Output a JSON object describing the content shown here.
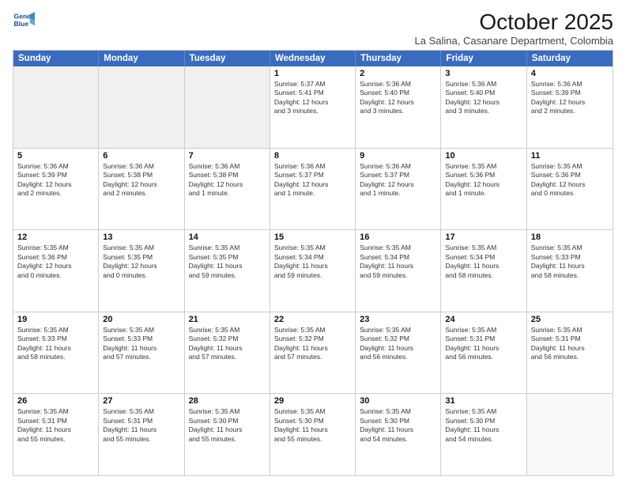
{
  "logo": {
    "line1": "General",
    "line2": "Blue"
  },
  "title": "October 2025",
  "subtitle": "La Salina, Casanare Department, Colombia",
  "header_days": [
    "Sunday",
    "Monday",
    "Tuesday",
    "Wednesday",
    "Thursday",
    "Friday",
    "Saturday"
  ],
  "rows": [
    [
      {
        "day": "",
        "info": ""
      },
      {
        "day": "",
        "info": ""
      },
      {
        "day": "",
        "info": ""
      },
      {
        "day": "1",
        "info": "Sunrise: 5:37 AM\nSunset: 5:41 PM\nDaylight: 12 hours\nand 3 minutes."
      },
      {
        "day": "2",
        "info": "Sunrise: 5:36 AM\nSunset: 5:40 PM\nDaylight: 12 hours\nand 3 minutes."
      },
      {
        "day": "3",
        "info": "Sunrise: 5:36 AM\nSunset: 5:40 PM\nDaylight: 12 hours\nand 3 minutes."
      },
      {
        "day": "4",
        "info": "Sunrise: 5:36 AM\nSunset: 5:39 PM\nDaylight: 12 hours\nand 2 minutes."
      }
    ],
    [
      {
        "day": "5",
        "info": "Sunrise: 5:36 AM\nSunset: 5:39 PM\nDaylight: 12 hours\nand 2 minutes."
      },
      {
        "day": "6",
        "info": "Sunrise: 5:36 AM\nSunset: 5:38 PM\nDaylight: 12 hours\nand 2 minutes."
      },
      {
        "day": "7",
        "info": "Sunrise: 5:36 AM\nSunset: 5:38 PM\nDaylight: 12 hours\nand 1 minute."
      },
      {
        "day": "8",
        "info": "Sunrise: 5:36 AM\nSunset: 5:37 PM\nDaylight: 12 hours\nand 1 minute."
      },
      {
        "day": "9",
        "info": "Sunrise: 5:36 AM\nSunset: 5:37 PM\nDaylight: 12 hours\nand 1 minute."
      },
      {
        "day": "10",
        "info": "Sunrise: 5:35 AM\nSunset: 5:36 PM\nDaylight: 12 hours\nand 1 minute."
      },
      {
        "day": "11",
        "info": "Sunrise: 5:35 AM\nSunset: 5:36 PM\nDaylight: 12 hours\nand 0 minutes."
      }
    ],
    [
      {
        "day": "12",
        "info": "Sunrise: 5:35 AM\nSunset: 5:36 PM\nDaylight: 12 hours\nand 0 minutes."
      },
      {
        "day": "13",
        "info": "Sunrise: 5:35 AM\nSunset: 5:35 PM\nDaylight: 12 hours\nand 0 minutes."
      },
      {
        "day": "14",
        "info": "Sunrise: 5:35 AM\nSunset: 5:35 PM\nDaylight: 11 hours\nand 59 minutes."
      },
      {
        "day": "15",
        "info": "Sunrise: 5:35 AM\nSunset: 5:34 PM\nDaylight: 11 hours\nand 59 minutes."
      },
      {
        "day": "16",
        "info": "Sunrise: 5:35 AM\nSunset: 5:34 PM\nDaylight: 11 hours\nand 59 minutes."
      },
      {
        "day": "17",
        "info": "Sunrise: 5:35 AM\nSunset: 5:34 PM\nDaylight: 11 hours\nand 58 minutes."
      },
      {
        "day": "18",
        "info": "Sunrise: 5:35 AM\nSunset: 5:33 PM\nDaylight: 11 hours\nand 58 minutes."
      }
    ],
    [
      {
        "day": "19",
        "info": "Sunrise: 5:35 AM\nSunset: 5:33 PM\nDaylight: 11 hours\nand 58 minutes."
      },
      {
        "day": "20",
        "info": "Sunrise: 5:35 AM\nSunset: 5:33 PM\nDaylight: 11 hours\nand 57 minutes."
      },
      {
        "day": "21",
        "info": "Sunrise: 5:35 AM\nSunset: 5:32 PM\nDaylight: 11 hours\nand 57 minutes."
      },
      {
        "day": "22",
        "info": "Sunrise: 5:35 AM\nSunset: 5:32 PM\nDaylight: 11 hours\nand 57 minutes."
      },
      {
        "day": "23",
        "info": "Sunrise: 5:35 AM\nSunset: 5:32 PM\nDaylight: 11 hours\nand 56 minutes."
      },
      {
        "day": "24",
        "info": "Sunrise: 5:35 AM\nSunset: 5:31 PM\nDaylight: 11 hours\nand 56 minutes."
      },
      {
        "day": "25",
        "info": "Sunrise: 5:35 AM\nSunset: 5:31 PM\nDaylight: 11 hours\nand 56 minutes."
      }
    ],
    [
      {
        "day": "26",
        "info": "Sunrise: 5:35 AM\nSunset: 5:31 PM\nDaylight: 11 hours\nand 55 minutes."
      },
      {
        "day": "27",
        "info": "Sunrise: 5:35 AM\nSunset: 5:31 PM\nDaylight: 11 hours\nand 55 minutes."
      },
      {
        "day": "28",
        "info": "Sunrise: 5:35 AM\nSunset: 5:30 PM\nDaylight: 11 hours\nand 55 minutes."
      },
      {
        "day": "29",
        "info": "Sunrise: 5:35 AM\nSunset: 5:30 PM\nDaylight: 11 hours\nand 55 minutes."
      },
      {
        "day": "30",
        "info": "Sunrise: 5:35 AM\nSunset: 5:30 PM\nDaylight: 11 hours\nand 54 minutes."
      },
      {
        "day": "31",
        "info": "Sunrise: 5:35 AM\nSunset: 5:30 PM\nDaylight: 11 hours\nand 54 minutes."
      },
      {
        "day": "",
        "info": ""
      }
    ]
  ]
}
